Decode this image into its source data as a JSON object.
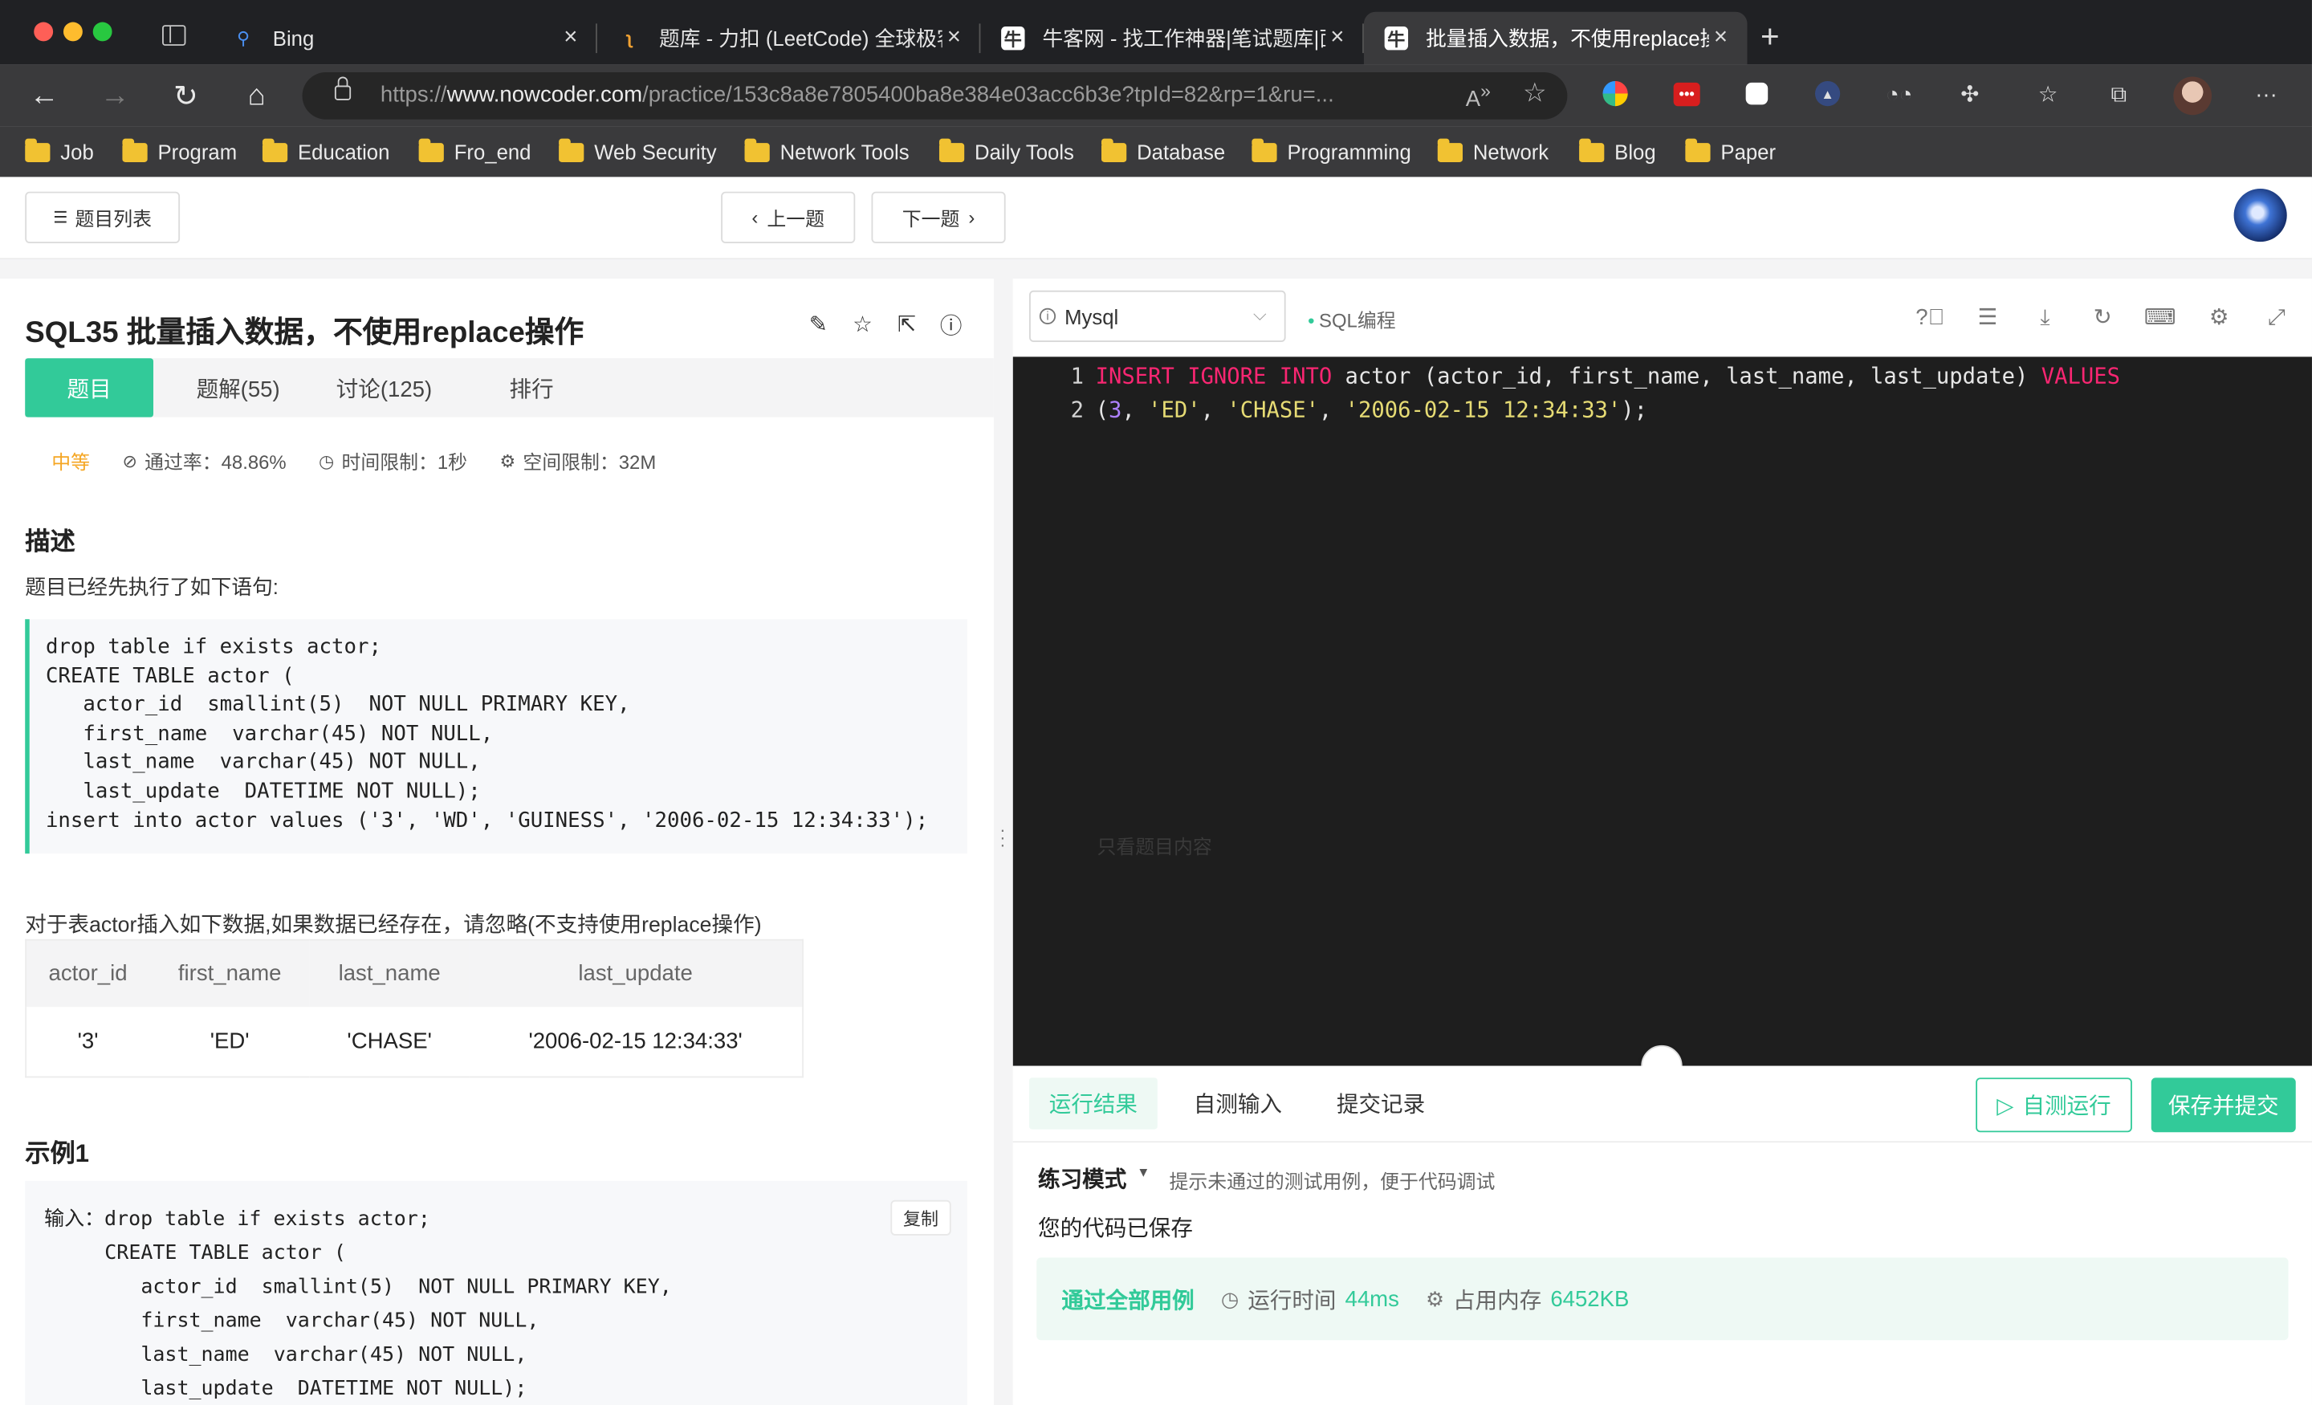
{
  "browser": {
    "tabs": [
      {
        "label": "Bing",
        "icon": "bing-search-icon"
      },
      {
        "label": "题库 - 力扣 (LeetCode) 全球极客挚爱的技术成长平台",
        "icon": "leetcode-icon"
      },
      {
        "label": "牛客网 - 找工作神器|笔试题库|面试经验|实习招聘内推",
        "icon": "nowcoder-icon"
      },
      {
        "label": "批量插入数据，不使用replace操作",
        "icon": "nowcoder-icon"
      }
    ],
    "url_prefix": "https://",
    "url_host": "www.nowcoder.com",
    "url_path": "/practice/153c8a8e7805400ba8e384e03acc6b3e?tpId=82&rp=1&ru=...",
    "bookmarks": [
      "Job",
      "Program",
      "Education",
      "Fro_end",
      "Web Security",
      "Network Tools",
      "Daily Tools",
      "Database",
      "Programming",
      "Network",
      "Blog",
      "Paper"
    ]
  },
  "header": {
    "list_button": "题目列表",
    "prev_button": "上一题",
    "next_button": "下一题"
  },
  "question": {
    "title": "SQL35  批量插入数据，不使用replace操作",
    "tabs": [
      "题目",
      "题解(55)",
      "讨论(125)",
      "排行"
    ],
    "difficulty": "中等",
    "pass_rate": "通过率：48.86%",
    "time_limit": "时间限制：1秒",
    "space_limit": "空间限制：32M",
    "desc_title": "描述",
    "desc_intro": "题目已经先执行了如下语句:",
    "setup_code": "drop table if exists actor;\nCREATE TABLE actor (\n   actor_id  smallint(5)  NOT NULL PRIMARY KEY,\n   first_name  varchar(45) NOT NULL,\n   last_name  varchar(45) NOT NULL,\n   last_update  DATETIME NOT NULL);\ninsert into actor values ('3', 'WD', 'GUINESS', '2006-02-15 12:34:33');",
    "task": "对于表actor插入如下数据,如果数据已经存在，请忽略(不支持使用replace操作)",
    "table_headers": [
      "actor_id",
      "first_name",
      "last_name",
      "last_update"
    ],
    "table_row": [
      "'3'",
      "'ED'",
      "'CHASE'",
      "'2006-02-15 12:34:33'"
    ],
    "example_title": "示例1",
    "example_label": "输入：",
    "example_code": "drop table if exists actor;\n     CREATE TABLE actor (\n        actor_id  smallint(5)  NOT NULL PRIMARY KEY,\n        first_name  varchar(45) NOT NULL,\n        last_name  varchar(45) NOT NULL,\n        last_update  DATETIME NOT NULL);",
    "copy_button": "复制"
  },
  "editor": {
    "language": "Mysql",
    "mode_tag": "SQL编程",
    "line1_no": "1",
    "line2_no": "2",
    "overlay_hint": "只看题目内容"
  },
  "result": {
    "tabs": [
      "运行结果",
      "自测输入",
      "提交记录"
    ],
    "run_button": "自测运行",
    "submit_button": "保存并提交",
    "mode": "练习模式",
    "mode_hint": "提示未通过的测试用例，便于代码调试",
    "saved_msg": "您的代码已保存",
    "pass_msg": "通过全部用例",
    "runtime_label": "运行时间",
    "runtime_value": "44ms",
    "memory_label": "占用内存",
    "memory_value": "6452KB"
  },
  "colors": {
    "accent": "#32ca99",
    "difficulty": "#f5a623",
    "editor_bg": "#1e1e1e",
    "keyword": "#f92672",
    "string": "#e6db74",
    "number": "#ae81ff"
  }
}
